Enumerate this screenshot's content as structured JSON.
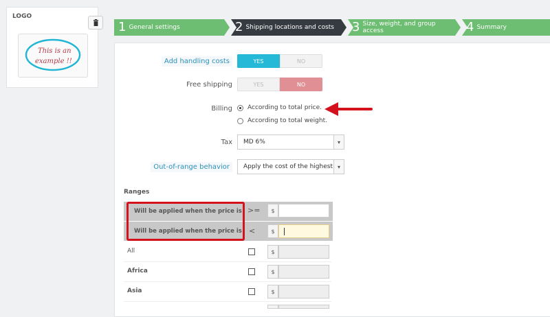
{
  "logo_card": {
    "title": "LOGO",
    "preview_text_line1": "This is an",
    "preview_text_line2": "example !!"
  },
  "wizard": {
    "steps": [
      {
        "num": "1",
        "label": "General settings",
        "state": "done"
      },
      {
        "num": "2",
        "label": "Shipping locations and costs",
        "state": "active"
      },
      {
        "num": "3",
        "label": "Size, weight, and group access",
        "state": "done"
      },
      {
        "num": "4",
        "label": "Summary",
        "state": "done"
      }
    ]
  },
  "form": {
    "handling": {
      "label": "Add handling costs",
      "yes": "YES",
      "no": "NO",
      "value": "yes"
    },
    "free_shipping": {
      "label": "Free shipping",
      "yes": "YES",
      "no": "NO",
      "value": "no"
    },
    "billing": {
      "label": "Billing",
      "options": [
        {
          "label": "According to total price.",
          "checked": true
        },
        {
          "label": "According to total weight.",
          "checked": false
        }
      ]
    },
    "tax": {
      "label": "Tax",
      "value": "MD 6%"
    },
    "out_of_range": {
      "label": "Out-of-range behavior",
      "value": "Apply the cost of the highest"
    }
  },
  "ranges": {
    "title": "Ranges",
    "rows": [
      {
        "label": "Will be applied when the price is",
        "operator": ">=",
        "currency": "$",
        "value": ""
      },
      {
        "label": "Will be applied when the price is",
        "operator": "<",
        "currency": "$",
        "value": ""
      }
    ],
    "zones": [
      {
        "name": "All",
        "bold": false,
        "currency": "$"
      },
      {
        "name": "Africa",
        "bold": true,
        "currency": "$"
      },
      {
        "name": "Asia",
        "bold": true,
        "currency": "$"
      },
      {
        "name": "",
        "bold": false,
        "currency": "$"
      }
    ]
  },
  "colors": {
    "step_done": "#6dbd72",
    "step_active": "#363a41",
    "accent": "#25b9d7",
    "no_active": "#e08f95",
    "highlight_border": "#d4121d"
  },
  "icons": {
    "trash": "trash-icon",
    "arrow": "red-arrow-annotation",
    "caret": "chevron-down-icon"
  }
}
